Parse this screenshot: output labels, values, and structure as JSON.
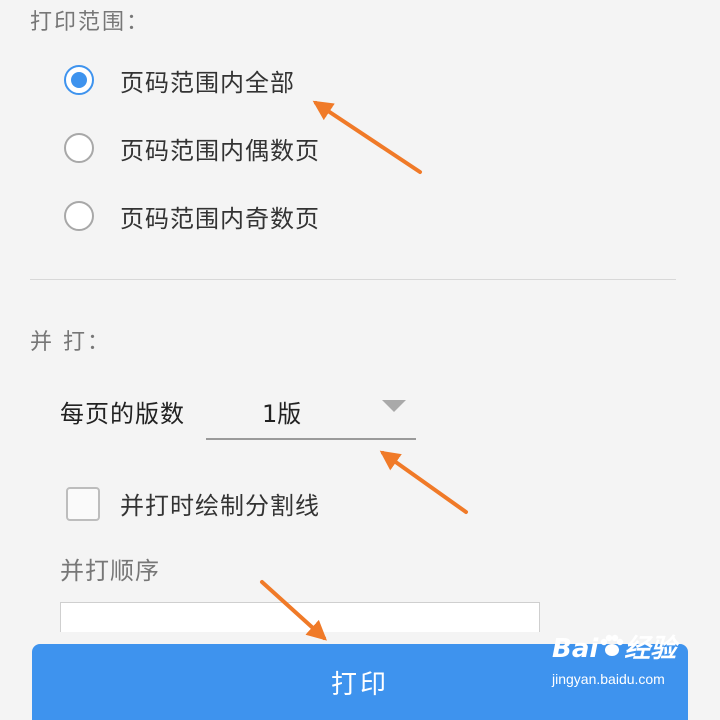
{
  "print_range": {
    "label": "打印范围：",
    "options": [
      {
        "label": "页码范围内全部",
        "checked": true
      },
      {
        "label": "页码范围内偶数页",
        "checked": false
      },
      {
        "label": "页码范围内奇数页",
        "checked": false
      }
    ]
  },
  "combine": {
    "label": "并 打：",
    "pages_per_sheet_label": "每页的版数",
    "pages_per_sheet_value": "1版",
    "draw_divider_label": "并打时绘制分割线",
    "draw_divider_checked": false,
    "order_label": "并打顺序"
  },
  "print_button_label": "打印",
  "watermark": {
    "brand": "Bai",
    "brand_suffix": "经验",
    "url": "jingyan.baidu.com"
  },
  "colors": {
    "accent": "#3e93ee",
    "annotation_arrow": "#f07a28"
  },
  "icons": {
    "dropdown": "triangle-down-icon",
    "paw": "baidu-paw-icon"
  }
}
